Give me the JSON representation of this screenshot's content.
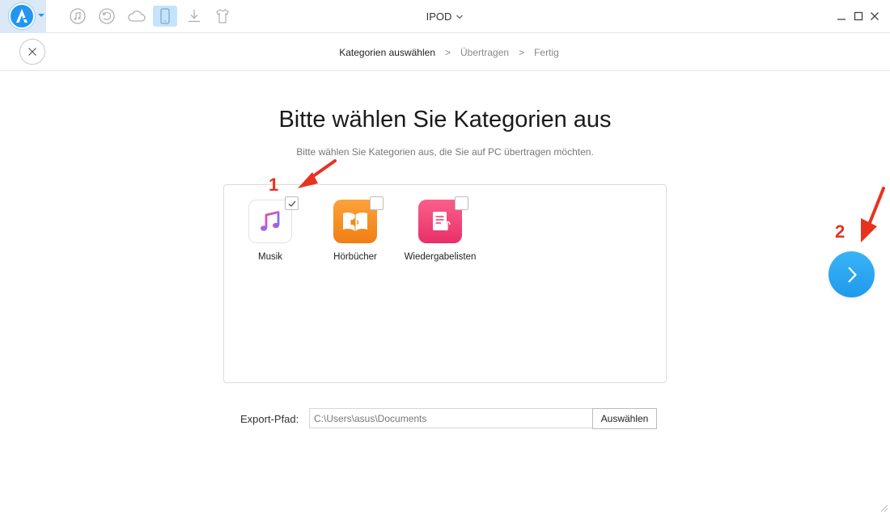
{
  "titlebar": {
    "title": "IPOD",
    "toolbar": [
      {
        "icon": "music-note-icon"
      },
      {
        "icon": "restore-icon"
      },
      {
        "icon": "cloud-icon"
      },
      {
        "icon": "device-icon",
        "active": true
      },
      {
        "icon": "download-icon"
      },
      {
        "icon": "tshirt-icon"
      }
    ]
  },
  "steps": {
    "step1": "Kategorien auswählen",
    "sep1": ">",
    "step2": "Übertragen",
    "sep2": ">",
    "step3": "Fertig"
  },
  "main": {
    "heading": "Bitte wählen Sie Kategorien aus",
    "subheading": "Bitte wählen Sie Kategorien aus, die Sie auf PC übertragen möchten."
  },
  "categories": [
    {
      "label": "Musik",
      "checked": true,
      "color": "#ffffff"
    },
    {
      "label": "Hörbücher",
      "checked": false,
      "color": "#f7941d"
    },
    {
      "label": "Wiedergabelisten",
      "checked": false,
      "color": "#f0457a"
    }
  ],
  "export": {
    "label": "Export-Pfad:",
    "value": "C:\\Users\\asus\\Documents",
    "button": "Auswählen"
  },
  "annotations": {
    "one": "1",
    "two": "2"
  },
  "colors": {
    "accent": "#2196f3",
    "annotation": "#e8321f"
  }
}
